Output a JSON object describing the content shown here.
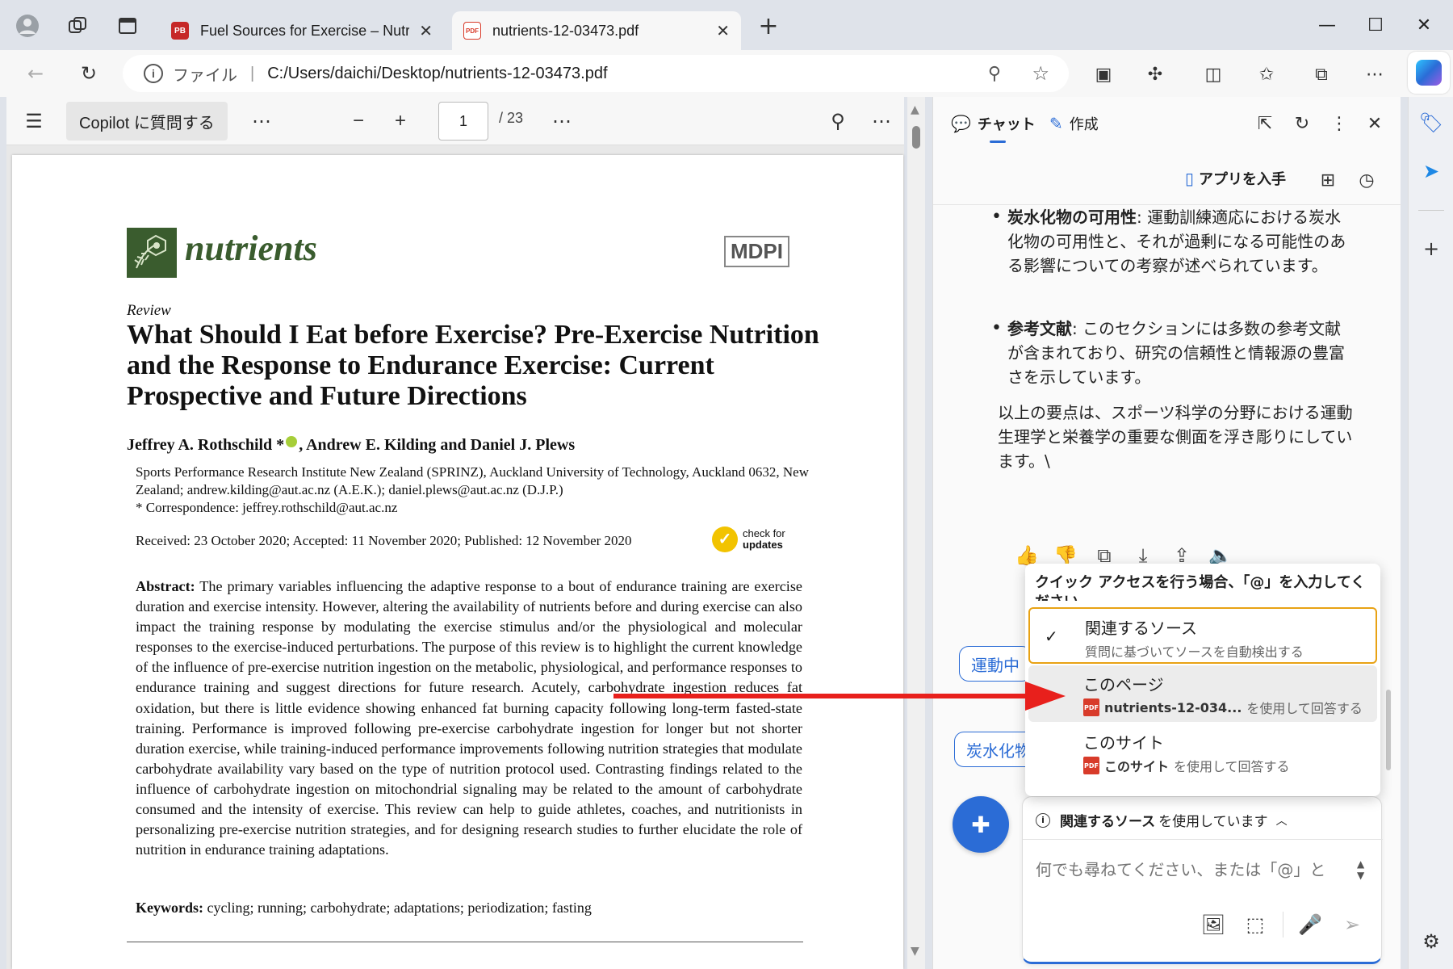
{
  "browser": {
    "tabs": [
      {
        "label": "Fuel Sources for Exercise – Nutrit",
        "favicon": "PB"
      },
      {
        "label": "nutrients-12-03473.pdf",
        "favicon": "PDF"
      }
    ],
    "new_tab": "+",
    "address": {
      "scheme": "ファイル",
      "url": "C:/Users/daichi/Desktop/nutrients-12-03473.pdf"
    },
    "window_controls": [
      "minimize",
      "maximize",
      "close"
    ]
  },
  "pdf_toolbar": {
    "ask_copilot": "Copilot に質問する",
    "more": "⋯",
    "zoom_out": "−",
    "zoom_in": "+",
    "page_current": "1",
    "page_total": "/ 23"
  },
  "paper": {
    "journal": "nutrients",
    "publisher": "MDPI",
    "article_type": "Review",
    "title": "What Should I Eat before Exercise? Pre-Exercise Nutrition and the Response to Endurance Exercise: Current Prospective and Future Directions",
    "authors": "Jeffrey A. Rothschild *",
    "authors_rest": ", Andrew E. Kilding and Daniel J. Plews",
    "affiliation_1": "Sports Performance Research Institute New Zealand (SPRINZ), Auckland University of Technology, Auckland 0632, New Zealand; andrew.kilding@aut.ac.nz (A.E.K.); daniel.plews@aut.ac.nz (D.J.P.)",
    "correspondence": "*  Correspondence: jeffrey.rothschild@aut.ac.nz",
    "dates": "Received: 23 October 2020; Accepted: 11 November 2020; Published: 12 November 2020",
    "check_updates_1": "check for",
    "check_updates_2": "updates",
    "abstract_label": "Abstract:",
    "abstract": "The primary variables influencing the adaptive response to a bout of endurance training are exercise duration and exercise intensity. However, altering the availability of nutrients before and during exercise can also impact the training response by modulating the exercise stimulus and/or the physiological and molecular responses to the exercise-induced perturbations. The purpose of this review is to highlight the current knowledge of the influence of pre-exercise nutrition ingestion on the metabolic, physiological, and performance responses to endurance training and suggest directions for future research. Acutely, carbohydrate ingestion reduces fat oxidation, but there is little evidence showing enhanced fat burning capacity following long-term fasted-state training. Performance is improved following pre-exercise carbohydrate ingestion for longer but not shorter duration exercise, while training-induced performance improvements following nutrition strategies that modulate carbohydrate availability vary based on the type of nutrition protocol used. Contrasting findings related to the influence of carbohydrate ingestion on mitochondrial signaling may be related to the amount of carbohydrate consumed and the intensity of exercise. This review can help to guide athletes, coaches, and nutritionists in personalizing pre-exercise nutrition strategies, and for designing research studies to further elucidate the role of nutrition in endurance training adaptations.",
    "keywords_label": "Keywords:",
    "keywords": "cycling; running; carbohydrate; adaptations; periodization; fasting"
  },
  "copilot": {
    "tab_chat": "チャット",
    "tab_compose": "作成",
    "get_app": "アプリを入手",
    "bullet_1_bold": "炭水化物の可用性",
    "bullet_1_text": ": 運動訓練適応における炭水化物の可用性と、それが過剰になる可能性のある影響についての考察が述べられています。",
    "bullet_2_bold": "参考文献",
    "bullet_2_text": ": このセクションには多数の参考文献が含まれており、研究の信頼性と情報源の豊富さを示しています。",
    "summary": "以上の要点は、スポーツ科学の分野における運動生理学と栄養学の重要な側面を浮き彫りにしています。\\",
    "chip_1": "運動中",
    "chip_2": "炭水化物",
    "source_status_bold": "関連するソース",
    "source_status_rest": "を使用しています",
    "input_placeholder": "何でも尋ねてください、または「@」と"
  },
  "quick_access": {
    "hint": "クイック アクセスを行う場合、「@」を入力してください",
    "items": [
      {
        "label": "関連するソース",
        "desc": "質問に基づいてソースを自動検出する",
        "checked": true
      },
      {
        "label": "このページ",
        "desc_bold": "nutrients-12-034...",
        "desc": "を使用して回答する"
      },
      {
        "label": "このサイト",
        "desc_bold": "このサイト",
        "desc": "を使用して回答する"
      }
    ]
  },
  "colors": {
    "accent": "#2b6cd6",
    "selected_border": "#e8a214",
    "arrow": "#e8201c",
    "journal_green": "#3a5c2e",
    "pdf_red": "#d83b2a"
  }
}
